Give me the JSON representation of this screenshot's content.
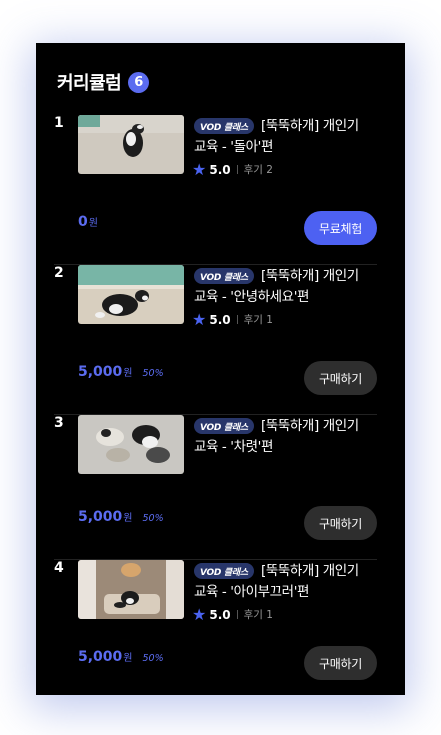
{
  "header": {
    "title": "커리큘럼",
    "count": "6"
  },
  "vod_label": "VOD 클래스",
  "items": [
    {
      "num": "1",
      "title": "[뚝뚝하개] 개인기 교육 - '돌아'편",
      "score": "5.0",
      "reviews": "후기 2",
      "price": "0",
      "unit": "원",
      "discount": "",
      "button": "무료체험",
      "thumb_icon": "dog-spinning-thumbnail"
    },
    {
      "num": "2",
      "title": "[뚝뚝하개] 개인기 교육 - '안녕하세요'편",
      "score": "5.0",
      "reviews": "후기 1",
      "price": "5,000",
      "unit": "원",
      "discount": "50%",
      "button": "구매하기",
      "thumb_icon": "dog-sitting-thumbnail"
    },
    {
      "num": "3",
      "title": "[뚝뚝하개] 개인기 교육 - '차렷'편",
      "score": "",
      "reviews": "",
      "price": "5,000",
      "unit": "원",
      "discount": "50%",
      "button": "구매하기",
      "thumb_icon": "dog-lying-thumbnail"
    },
    {
      "num": "4",
      "title": "[뚝뚝하개] 개인기 교육 - '아이부끄러'편",
      "score": "5.0",
      "reviews": "후기 1",
      "price": "5,000",
      "unit": "원",
      "discount": "50%",
      "button": "구매하기",
      "thumb_icon": "dog-sofa-thumbnail"
    }
  ],
  "colors": {
    "accent": "#4d61f2",
    "badge": "#5b6cf0",
    "vod_badge": "#28366a",
    "buy_button": "#2e2e2e",
    "background": "#000000"
  }
}
